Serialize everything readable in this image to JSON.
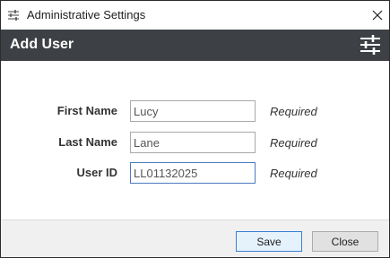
{
  "window": {
    "title": "Administrative Settings",
    "icon": "sliders-icon"
  },
  "header": {
    "title": "Add User",
    "icon": "settings-sliders-icon"
  },
  "form": {
    "fields": [
      {
        "label": "First Name",
        "value": "Lucy",
        "hint": "Required"
      },
      {
        "label": "Last Name",
        "value": "Lane",
        "hint": "Required"
      },
      {
        "label": "User ID",
        "value": "LL01132025",
        "hint": "Required"
      }
    ]
  },
  "footer": {
    "save_label": "Save",
    "close_label": "Close"
  },
  "colors": {
    "header_bg": "#3d4044",
    "focus_border": "#4a7bc0",
    "default_button_border": "#3c7fd6"
  }
}
